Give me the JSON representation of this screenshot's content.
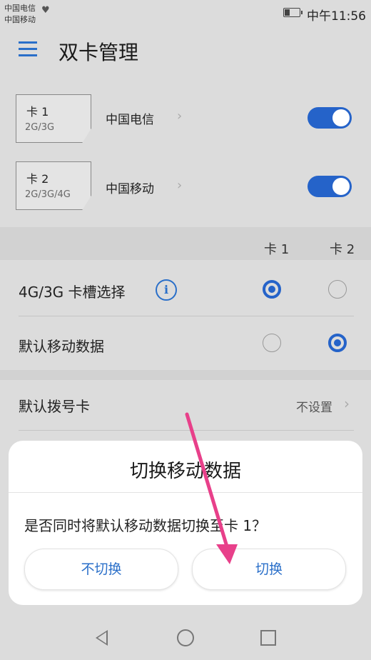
{
  "status_bar": {
    "carrier1": "中国电信",
    "carrier2": "中国移动",
    "time": "中午11:56",
    "battery_icon": "battery-icon",
    "health_icon": "heart-rate-icon"
  },
  "app_bar": {
    "title": "双卡管理",
    "menu_icon": "hamburger-menu-icon"
  },
  "sims": [
    {
      "slot": "卡 1",
      "network": "2G/3G",
      "carrier": "中国电信",
      "enabled": true
    },
    {
      "slot": "卡 2",
      "network": "2G/3G/4G",
      "carrier": "中国移动",
      "enabled": true
    }
  ],
  "columns": {
    "card1": "卡 1",
    "card2": "卡 2"
  },
  "settings": {
    "slot_select": {
      "label": "4G/3G 卡槽选择",
      "selected": "card1"
    },
    "default_data": {
      "label": "默认移动数据",
      "selected": "card2"
    },
    "default_dial": {
      "label": "默认拨号卡",
      "value": "不设置"
    }
  },
  "dialog": {
    "title": "切换移动数据",
    "message": "是否同时将默认移动数据切换至卡 1？",
    "cancel_label": "不切换",
    "confirm_label": "切换"
  },
  "colors": {
    "accent": "#2563c9",
    "annotation_arrow": "#e8408a"
  }
}
